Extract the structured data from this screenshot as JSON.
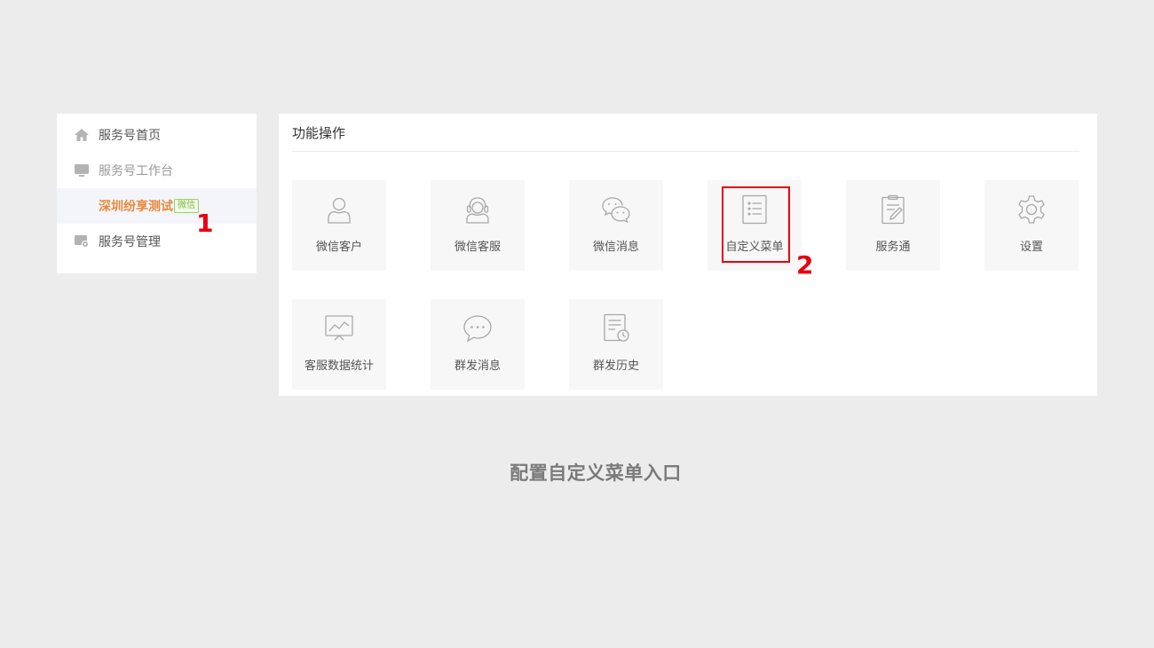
{
  "sidebar": {
    "items": [
      {
        "label": "服务号首页",
        "icon": "home-icon"
      },
      {
        "label": "服务号工作台",
        "icon": "monitor-icon"
      },
      {
        "label": "深圳纷享测试",
        "badge": "微信"
      },
      {
        "label": "服务号管理",
        "icon": "settings-monitor-icon"
      }
    ]
  },
  "panel": {
    "title": "功能操作",
    "tiles": [
      {
        "label": "微信客户",
        "icon": "user-icon"
      },
      {
        "label": "微信客服",
        "icon": "headset-icon"
      },
      {
        "label": "微信消息",
        "icon": "wechat-icon"
      },
      {
        "label": "自定义菜单",
        "icon": "list-icon"
      },
      {
        "label": "服务通",
        "icon": "clipboard-edit-icon"
      },
      {
        "label": "设置",
        "icon": "gear-icon"
      },
      {
        "label": "客服数据统计",
        "icon": "chart-board-icon"
      },
      {
        "label": "群发消息",
        "icon": "chat-bubble-icon"
      },
      {
        "label": "群发历史",
        "icon": "document-clock-icon"
      }
    ]
  },
  "annotations": {
    "first": "1",
    "second": "2",
    "color": "#e60012"
  },
  "caption": "配置自定义菜单入口",
  "colors": {
    "accent": "#e8893a",
    "badge": "#80bd3d",
    "background": "#ececec"
  }
}
